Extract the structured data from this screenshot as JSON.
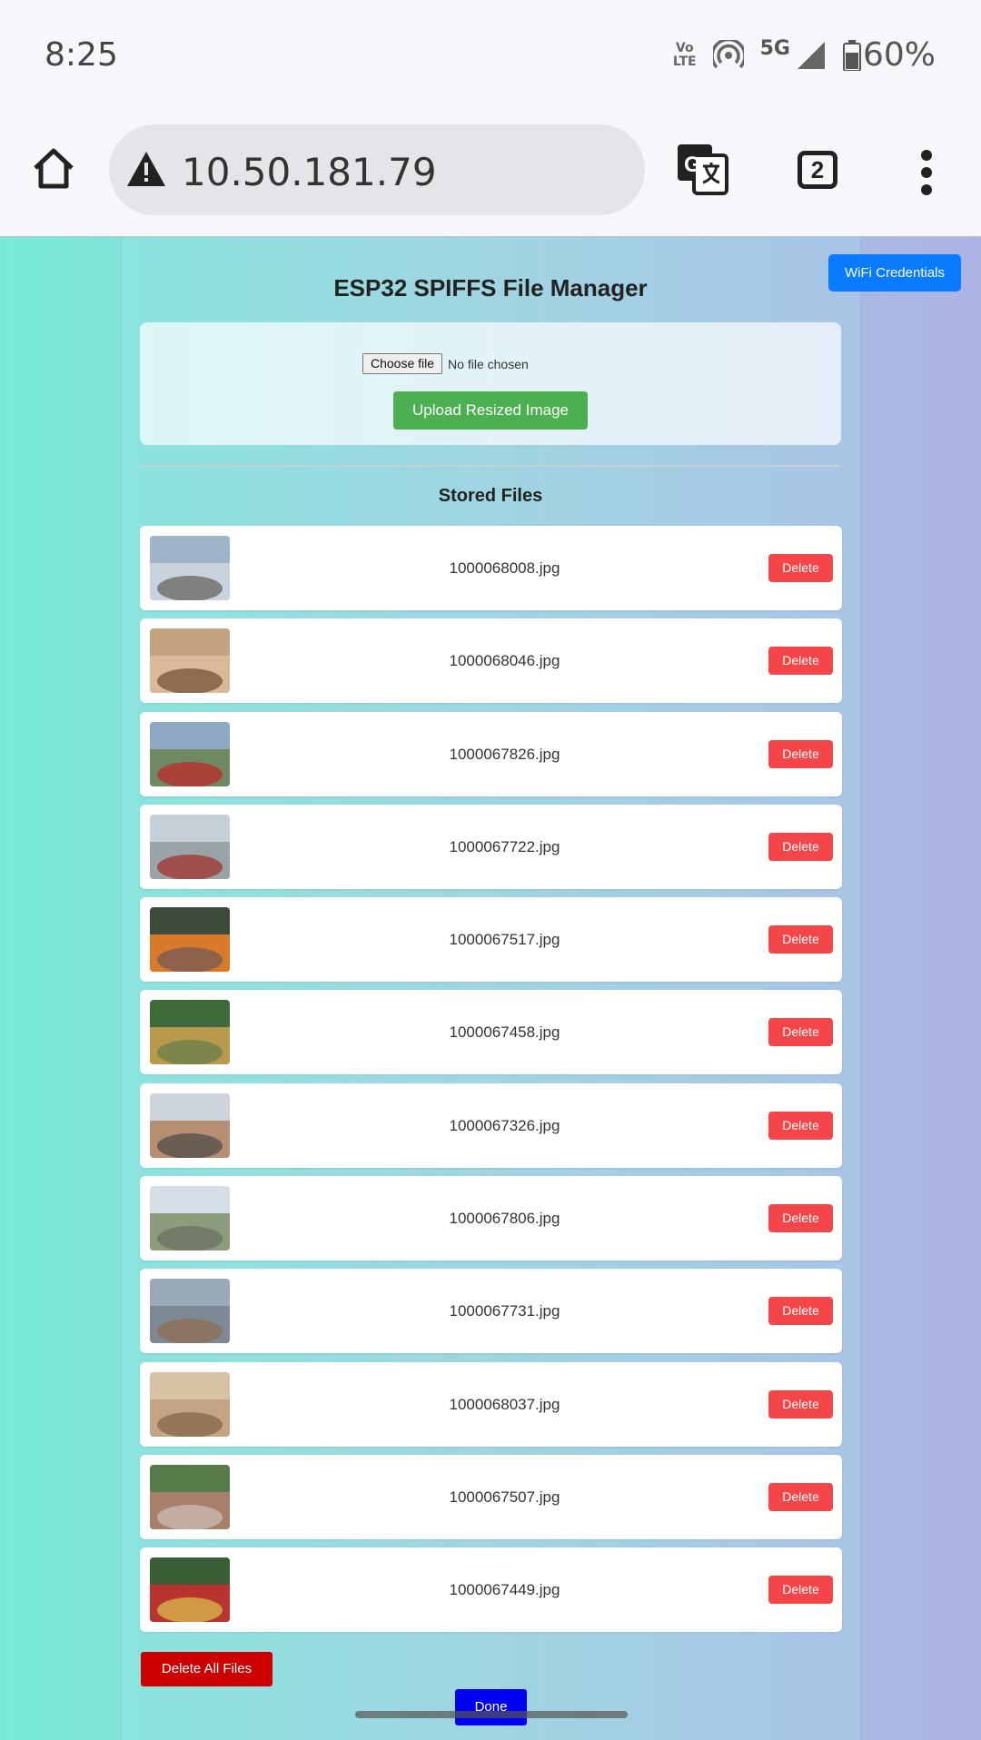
{
  "status_bar": {
    "time": "8:25",
    "volte_top": "Vo",
    "volte_bottom": "LTE",
    "network": "5G",
    "battery": "60%",
    "icons": [
      "volte-icon",
      "hotspot-icon",
      "signal-icon",
      "battery-icon"
    ]
  },
  "browser": {
    "url": "10.50.181.79",
    "tab_count": "2",
    "icons": [
      "home-icon",
      "warning-icon",
      "translate-icon",
      "menu-icon"
    ]
  },
  "page": {
    "wifi_button": "WiFi Credentials",
    "title": "ESP32 SPIFFS File Manager",
    "choose_file": "Choose file",
    "no_file": "No file chosen",
    "upload_button": "Upload Resized Image",
    "stored_title": "Stored Files",
    "delete_label": "Delete",
    "delete_all": "Delete All Files",
    "done": "Done"
  },
  "files": [
    {
      "name": "1000068008.jpg",
      "thumb": [
        "#9fb3c9",
        "#c9d3db",
        "#6d6d66"
      ]
    },
    {
      "name": "1000068046.jpg",
      "thumb": [
        "#c2a27f",
        "#d9b99a",
        "#7a5a3c"
      ]
    },
    {
      "name": "1000067826.jpg",
      "thumb": [
        "#8ea7c2",
        "#6f8a62",
        "#b8302f"
      ]
    },
    {
      "name": "1000067722.jpg",
      "thumb": [
        "#c6d0d9",
        "#9aa3a8",
        "#a23a36"
      ]
    },
    {
      "name": "1000067517.jpg",
      "thumb": [
        "#3e4b3c",
        "#d97a2b",
        "#7a5d53"
      ]
    },
    {
      "name": "1000067458.jpg",
      "thumb": [
        "#3f6a3a",
        "#b89a4d",
        "#6f7f4a"
      ]
    },
    {
      "name": "1000067326.jpg",
      "thumb": [
        "#cdd3da",
        "#b68f73",
        "#56504c"
      ]
    },
    {
      "name": "1000067806.jpg",
      "thumb": [
        "#d6dde4",
        "#8c9a7e",
        "#6e7363"
      ]
    },
    {
      "name": "1000067731.jpg",
      "thumb": [
        "#9aa9b8",
        "#7d8a95",
        "#8c6f54"
      ]
    },
    {
      "name": "1000068037.jpg",
      "thumb": [
        "#d8c2a4",
        "#c3a585",
        "#8a6a4d"
      ]
    },
    {
      "name": "1000067507.jpg",
      "thumb": [
        "#577a49",
        "#a87f6b",
        "#c9b9b0"
      ]
    },
    {
      "name": "1000067449.jpg",
      "thumb": [
        "#3a5e35",
        "#b9342e",
        "#d6b44a"
      ]
    }
  ]
}
